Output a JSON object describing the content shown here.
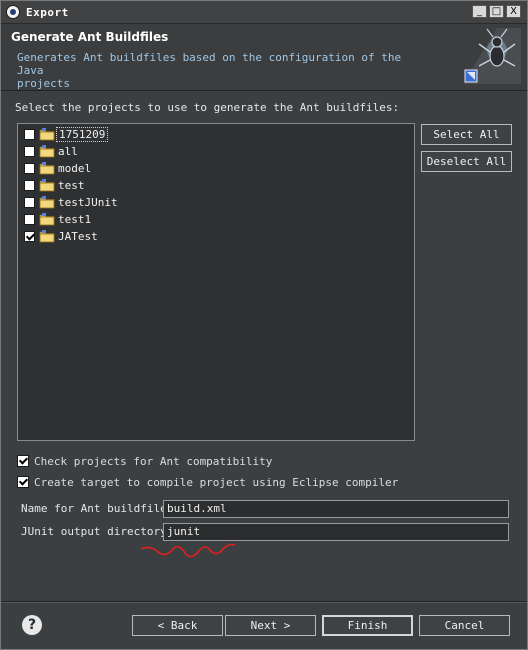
{
  "window": {
    "title": "Export",
    "controls": [
      "_",
      "□",
      "X"
    ]
  },
  "header": {
    "title": "Generate Ant Buildfiles",
    "description_line1": "Generates Ant buildfiles based on the configuration of the Java",
    "description_line2": "projects"
  },
  "projects": {
    "prompt": "Select the projects to use to generate the Ant buildfiles:",
    "items": [
      {
        "label": "1751209",
        "checked": false,
        "focused": true
      },
      {
        "label": "all",
        "checked": false
      },
      {
        "label": "model",
        "checked": false
      },
      {
        "label": "test",
        "checked": false
      },
      {
        "label": "testJUnit",
        "checked": false
      },
      {
        "label": "test1",
        "checked": false
      },
      {
        "label": "JATest",
        "checked": true
      }
    ],
    "select_all_label": "Select All",
    "deselect_all_label": "Deselect All"
  },
  "options": {
    "check_compat_label": "Check projects for Ant compatibility",
    "check_compat_checked": true,
    "create_target_label": "Create target to compile project using Eclipse compiler",
    "create_target_checked": true
  },
  "fields": {
    "buildfile_label": "Name for Ant buildfile:",
    "buildfile_value": "build.xml",
    "junit_label": "JUnit output directory:",
    "junit_value": "junit"
  },
  "footer": {
    "help_icon": "?",
    "back_label": "< Back",
    "next_label": "Next >",
    "finish_label": "Finish",
    "cancel_label": "Cancel"
  },
  "colors": {
    "background": "#3c3f41",
    "description_text": "#9ec7e6",
    "annotation_squiggle": "#e02020"
  }
}
